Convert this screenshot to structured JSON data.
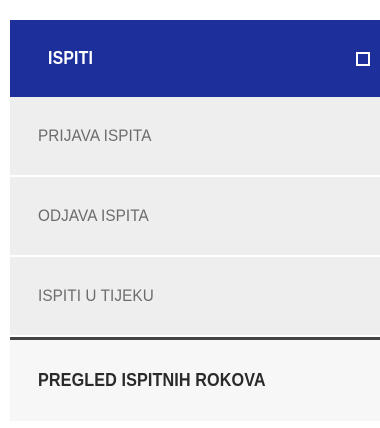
{
  "menu": {
    "header": {
      "label": "ISPITI",
      "toggle_icon": "checkbox-outline-icon"
    },
    "items": [
      {
        "label": "PRIJAVA ISPITA",
        "active": false
      },
      {
        "label": "ODJAVA ISPITA",
        "active": false
      },
      {
        "label": "ISPITI U TIJEKU",
        "active": false
      },
      {
        "label": "PREGLED ISPITNIH ROKOVA",
        "active": true
      }
    ]
  },
  "colors": {
    "header_bg": "#1d2f9b",
    "item_bg": "#eeeeee",
    "item_text": "#6c6c6c",
    "active_text": "#2a2a2a"
  }
}
